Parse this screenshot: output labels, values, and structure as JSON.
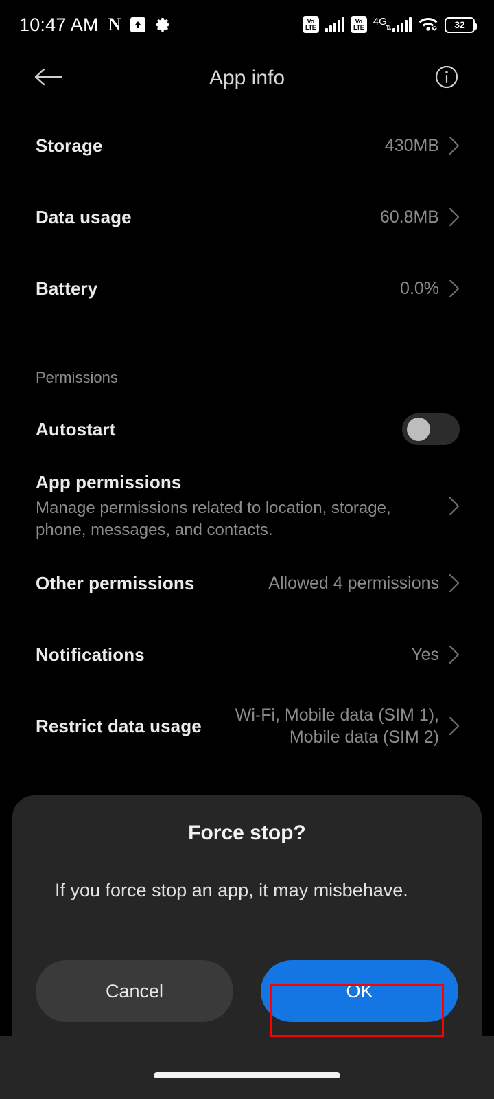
{
  "status_bar": {
    "time": "10:47 AM",
    "left_icons": [
      "nfc-n-icon",
      "upload-box-icon",
      "gear-icon"
    ],
    "volte_label_top": "Vo",
    "volte_label_bottom": "LTE",
    "network_type": "4G",
    "right_icons": [
      "volte-sim1-icon",
      "signal-sim1-icon",
      "volte-sim2-icon",
      "signal-sim2-icon",
      "wifi-icon",
      "battery-icon"
    ],
    "battery_percent": "32"
  },
  "app_bar": {
    "title": "App info",
    "back_icon": "arrow-left-icon",
    "info_icon": "info-circle-icon"
  },
  "list": {
    "items": [
      {
        "label": "Storage",
        "value": "430MB",
        "chevron": true
      },
      {
        "label": "Data usage",
        "value": "60.8MB",
        "chevron": true
      },
      {
        "label": "Battery",
        "value": "0.0%",
        "chevron": true
      }
    ],
    "section_label": "Permissions",
    "autostart": {
      "label": "Autostart",
      "toggle_state": "off"
    },
    "app_permissions": {
      "label": "App permissions",
      "description": "Manage permissions related to location, storage, phone, messages, and contacts.",
      "chevron": true
    },
    "other_permissions": {
      "label": "Other permissions",
      "value": "Allowed 4 permissions",
      "chevron": true
    },
    "notifications": {
      "label": "Notifications",
      "value": "Yes",
      "chevron": true
    },
    "restrict_data": {
      "label": "Restrict data usage",
      "value": "Wi-Fi, Mobile data (SIM 1), Mobile data (SIM 2)",
      "chevron": true
    }
  },
  "dialog": {
    "title": "Force stop?",
    "message": "If you force stop an app, it may misbehave.",
    "cancel_label": "Cancel",
    "ok_label": "OK"
  },
  "colors": {
    "background": "#000000",
    "dialog_background": "#262626",
    "primary_button": "#1376e3",
    "secondary_button": "#3a3a3a",
    "title_text": "#eaeaea",
    "value_text": "#8b8b8b",
    "highlight_outline": "#ff0000"
  }
}
